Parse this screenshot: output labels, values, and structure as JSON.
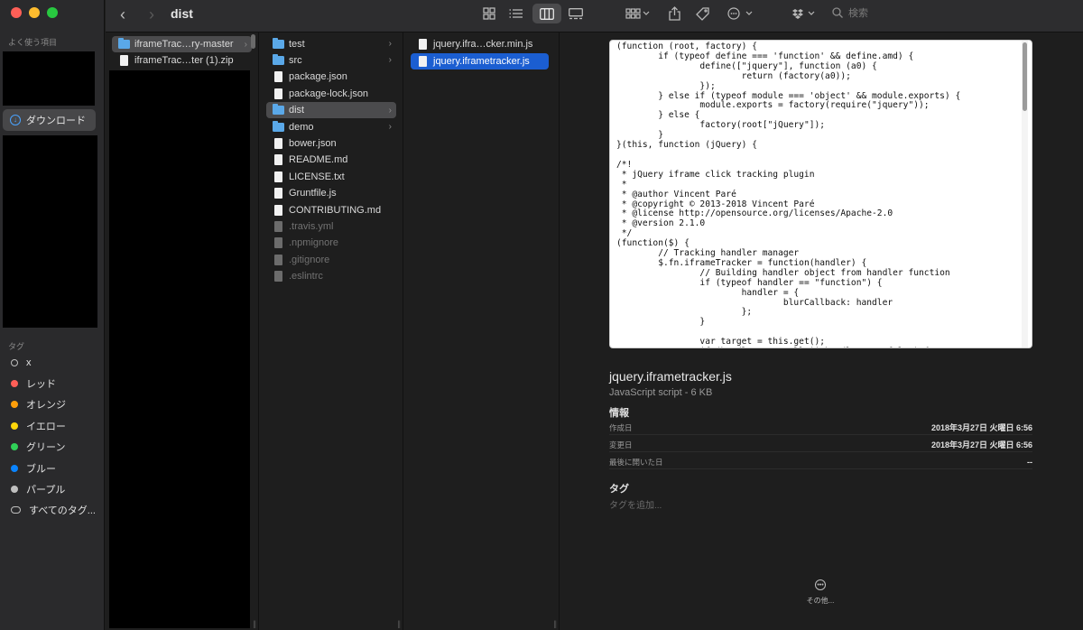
{
  "window": {
    "title": "dist"
  },
  "traffic_lights": {
    "close": "#ff5f57",
    "minimize": "#febc2e",
    "zoom": "#28c840"
  },
  "toolbar": {
    "back_icon": "chevron-left-icon",
    "forward_icon": "chevron-right-icon",
    "views": [
      "icon-view-icon",
      "list-view-icon",
      "column-view-icon",
      "gallery-view-icon"
    ],
    "active_view": "column-view-icon",
    "search_placeholder": "検索"
  },
  "sidebar": {
    "favorites_header": "よく使う項目",
    "downloads_label": "ダウンロード",
    "tags_header": "タグ",
    "tags": [
      {
        "label": "x",
        "color": "",
        "hollow": true
      },
      {
        "label": "レッド",
        "color": "#ff5f57"
      },
      {
        "label": "オレンジ",
        "color": "#ff9f0a"
      },
      {
        "label": "イエロー",
        "color": "#ffd60a"
      },
      {
        "label": "グリーン",
        "color": "#30d158"
      },
      {
        "label": "ブルー",
        "color": "#0a84ff"
      },
      {
        "label": "パープル",
        "color": "#bfbfbf"
      }
    ],
    "all_tags_label": "すべてのタグ..."
  },
  "column1": {
    "items": [
      {
        "name": "iframeTrac…ry-master",
        "type": "folder"
      },
      {
        "name": "iframeTrac…ter (1).zip",
        "type": "file"
      }
    ]
  },
  "column2": {
    "items": [
      {
        "name": "test",
        "type": "folder"
      },
      {
        "name": "src",
        "type": "folder"
      },
      {
        "name": "package.json",
        "type": "file"
      },
      {
        "name": "package-lock.json",
        "type": "file"
      },
      {
        "name": "dist",
        "type": "folder"
      },
      {
        "name": "demo",
        "type": "folder"
      },
      {
        "name": "bower.json",
        "type": "file"
      },
      {
        "name": "README.md",
        "type": "file"
      },
      {
        "name": "LICENSE.txt",
        "type": "file"
      },
      {
        "name": "Gruntfile.js",
        "type": "file"
      },
      {
        "name": "CONTRIBUTING.md",
        "type": "file"
      },
      {
        "name": ".travis.yml",
        "type": "file"
      },
      {
        "name": ".npmignore",
        "type": "file"
      },
      {
        "name": ".gitignore",
        "type": "file"
      },
      {
        "name": ".eslintrc",
        "type": "file"
      }
    ]
  },
  "column3": {
    "items": [
      {
        "name": "jquery.ifra…cker.min.js",
        "type": "file"
      },
      {
        "name": "jquery.iframetracker.js",
        "type": "file"
      }
    ]
  },
  "preview": {
    "code": "(function (root, factory) {\n\tif (typeof define === 'function' && define.amd) {\n\t\tdefine([\"jquery\"], function (a0) {\n\t\t\treturn (factory(a0));\n\t\t});\n\t} else if (typeof module === 'object' && module.exports) {\n\t\tmodule.exports = factory(require(\"jquery\"));\n\t} else {\n\t\tfactory(root[\"jQuery\"]);\n\t}\n}(this, function (jQuery) {\n\n/*!\n * jQuery iframe click tracking plugin\n *\n * @author Vincent Paré\n * @copyright © 2013-2018 Vincent Paré\n * @license http://opensource.org/licenses/Apache-2.0\n * @version 2.1.0\n */\n(function($) {\n\t// Tracking handler manager\n\t$.fn.iframeTracker = function(handler) {\n\t\t// Building handler object from handler function\n\t\tif (typeof handler == \"function\") {\n\t\t\thandler = {\n\t\t\t\tblurCallback: handler\n\t\t\t};\n\t\t}\n\n\t\tvar target = this.get();\n\t\tif (handler === null || handler === false) {",
    "file_name": "jquery.iframetracker.js",
    "file_kind": "JavaScript script - 6 KB",
    "info_header": "情報",
    "info": [
      {
        "key": "作成日",
        "value": "2018年3月27日 火曜日 6:56"
      },
      {
        "key": "変更日",
        "value": "2018年3月27日 火曜日 6:56"
      },
      {
        "key": "最後に開いた日",
        "value": "--"
      }
    ],
    "tags_header": "タグ",
    "add_tag_placeholder": "タグを追加...",
    "more_label": "その他..."
  }
}
